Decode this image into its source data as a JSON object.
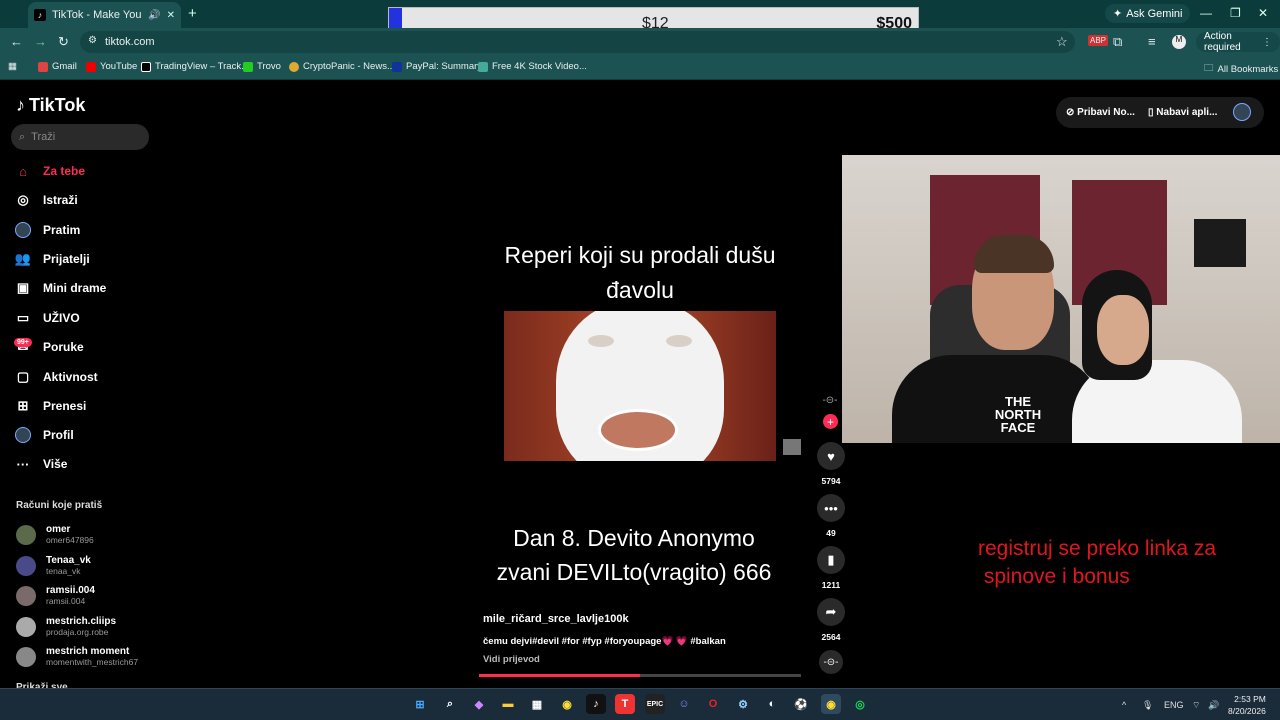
{
  "browser": {
    "tab_title": "TikTok - Make Your Day",
    "url": "tiktok.com",
    "ask_gemini": "Ask Gemini",
    "action_required": "Action required",
    "bookmarks": [
      "Gmail",
      "YouTube",
      "TradingView – Track...",
      "Trovo",
      "CryptoPanic - News...",
      "PayPal: Summary",
      "Free 4K Stock Video..."
    ],
    "all_bookmarks": "All Bookmarks"
  },
  "overlay": {
    "left_value": "$12",
    "right_value": "$500",
    "progress_fraction": 0.024
  },
  "tiktok": {
    "logo": "TikTok",
    "search_placeholder": "Traži",
    "nav": [
      {
        "label": "Za tebe",
        "icon": "home-icon"
      },
      {
        "label": "Istraži",
        "icon": "compass-icon"
      },
      {
        "label": "Pratim",
        "icon": "avatar-icon"
      },
      {
        "label": "Prijatelji",
        "icon": "friends-icon"
      },
      {
        "label": "Mini drame",
        "icon": "film-icon"
      },
      {
        "label": "UŽIVO",
        "icon": "live-icon"
      },
      {
        "label": "Poruke",
        "icon": "messages-icon"
      },
      {
        "label": "Aktivnost",
        "icon": "activity-icon"
      },
      {
        "label": "Prenesi",
        "icon": "upload-icon"
      },
      {
        "label": "Profil",
        "icon": "profile-icon"
      },
      {
        "label": "Više",
        "icon": "more-icon"
      }
    ],
    "messages_badge": "99+",
    "following_title": "Računi koje pratiš",
    "following": [
      {
        "name": "omer",
        "user": "omer647896"
      },
      {
        "name": "Tenaa_vk",
        "user": "tenaa_vk"
      },
      {
        "name": "ramsii.004",
        "user": "ramsii.004"
      },
      {
        "name": "mestrich.cliips",
        "user": "prodaja.org.robe"
      },
      {
        "name": "mestrich moment",
        "user": "momentwith_mestrich67"
      }
    ],
    "show_all": "Prikaži sve",
    "top_right": {
      "get_coins": "Pribavi No...",
      "get_app": "Nabavi apli..."
    }
  },
  "video": {
    "title": "Reperi koji su prodali dušu đavolu",
    "subtitle": "Dan 8. Devito Anonymo zvani DEVILto(vragito) 666",
    "author": "mile_ričard_srce_lavlje100k",
    "description": "čemu dejvi#devil #for #fyp #foryoupage💗 💗 #balkan",
    "see_more": "Vidi prijevod",
    "progress_fraction": 0.5,
    "likes": "5794",
    "comments": "49",
    "saves": "1211",
    "shares": "2564"
  },
  "webcam": {
    "shirt_text": "THE NORTH FACE"
  },
  "promo_text_line1": "registruj se preko linka za",
  "promo_text_line2": " spinove i bonus",
  "taskbar": {
    "lang": "ENG",
    "time": "2:53 PM",
    "date": "8/20/2026"
  },
  "colors": {
    "accent": "#fe2c55",
    "chrome": "#1d5252",
    "promo": "#e0161e"
  }
}
